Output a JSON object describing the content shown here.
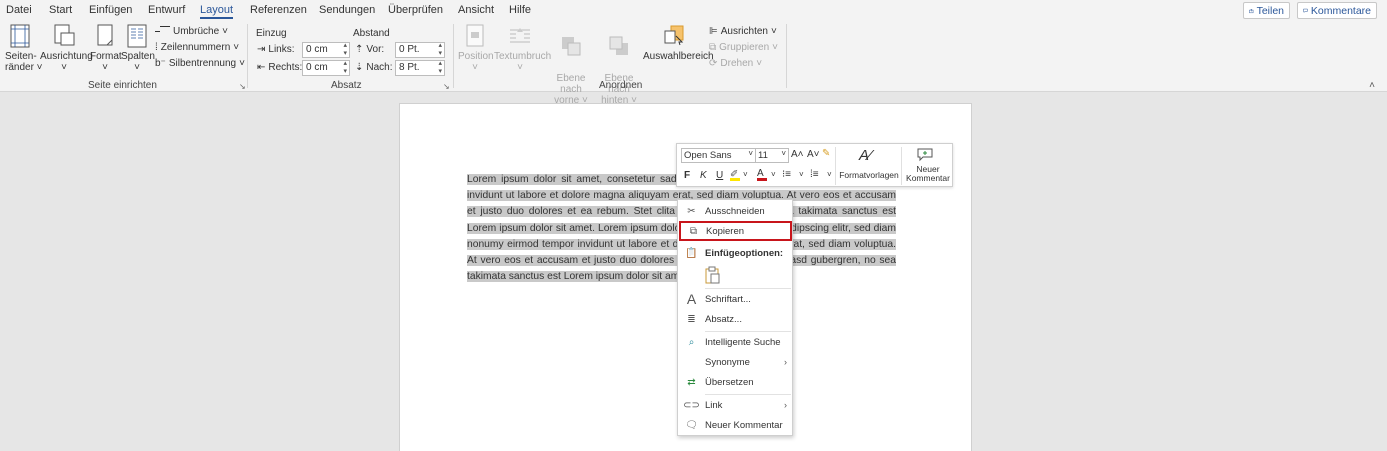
{
  "tabs": [
    "Datei",
    "Start",
    "Einfügen",
    "Entwurf",
    "Layout",
    "Referenzen",
    "Sendungen",
    "Überprüfen",
    "Ansicht",
    "Hilfe"
  ],
  "active_tab": "Layout",
  "share_label": "Teilen",
  "comments_label": "Kommentare",
  "ribbon": {
    "seite": {
      "seitenraender": "Seiten-\nränder",
      "ausrichtung": "Ausrichtung",
      "format": "Format",
      "spalten": "Spalten",
      "umbrueche": "Umbrüche",
      "zeilennummern": "Zeilennummern",
      "silbentrennung": "Silbentrennung",
      "group_label": "Seite einrichten"
    },
    "absatz": {
      "einzug": "Einzug",
      "abstand": "Abstand",
      "links_label": "Links:",
      "links_value": "0 cm",
      "rechts_label": "Rechts:",
      "rechts_value": "0 cm",
      "vor_label": "Vor:",
      "vor_value": "0 Pt.",
      "nach_label": "Nach:",
      "nach_value": "8 Pt.",
      "group_label": "Absatz"
    },
    "anordnen": {
      "position": "Position",
      "textumbruch": "Textumbruch",
      "ebene_vorne": "Ebene nach\nvorne",
      "ebene_hinten": "Ebene nach\nhinten",
      "auswahlbereich": "Auswahlbereich",
      "ausrichten": "Ausrichten",
      "gruppieren": "Gruppieren",
      "drehen": "Drehen",
      "group_label": "Anordnen"
    }
  },
  "document": {
    "text": "Lorem ipsum dolor sit amet, consetetur sadipscing elitr, sed diam nonumy eirmod tempor invidunt ut labore et dolore magna aliquyam erat, sed diam voluptua. At vero eos et accusam et justo duo dolores et ea rebum. Stet clita kasd gubergren, no sea takimata sanctus est Lorem ipsum dolor sit amet. Lorem ipsum dolor sit amet, consetetur sadipscing elitr, sed diam nonumy eirmod tempor invidunt ut labore et dolore magna aliquyam erat, sed diam voluptua. At vero eos et accusam et justo duo dolores et ea rebum. Stet clita kasd gubergren, no sea takimata sanctus est Lorem ipsum dolor sit amet."
  },
  "mini_toolbar": {
    "font": "Open Sans",
    "size": "11",
    "bold": "F",
    "italic": "K",
    "underline": "U",
    "formatvorlagen": "Formatvorlagen",
    "neuer_kommentar": "Neuer\nKommentar"
  },
  "context_menu": {
    "ausschneiden": "Ausschneiden",
    "kopieren": "Kopieren",
    "einfuegeoptionen": "Einfügeoptionen:",
    "schriftart": "Schriftart...",
    "absatz": "Absatz...",
    "intelligente_suche": "Intelligente Suche",
    "synonyme": "Synonyme",
    "uebersetzen": "Übersetzen",
    "link": "Link",
    "neuer_kommentar": "Neuer Kommentar"
  },
  "colors": {
    "accent": "#2b579a",
    "highlight_border": "#c8151b",
    "selection": "#c9c9c9"
  }
}
